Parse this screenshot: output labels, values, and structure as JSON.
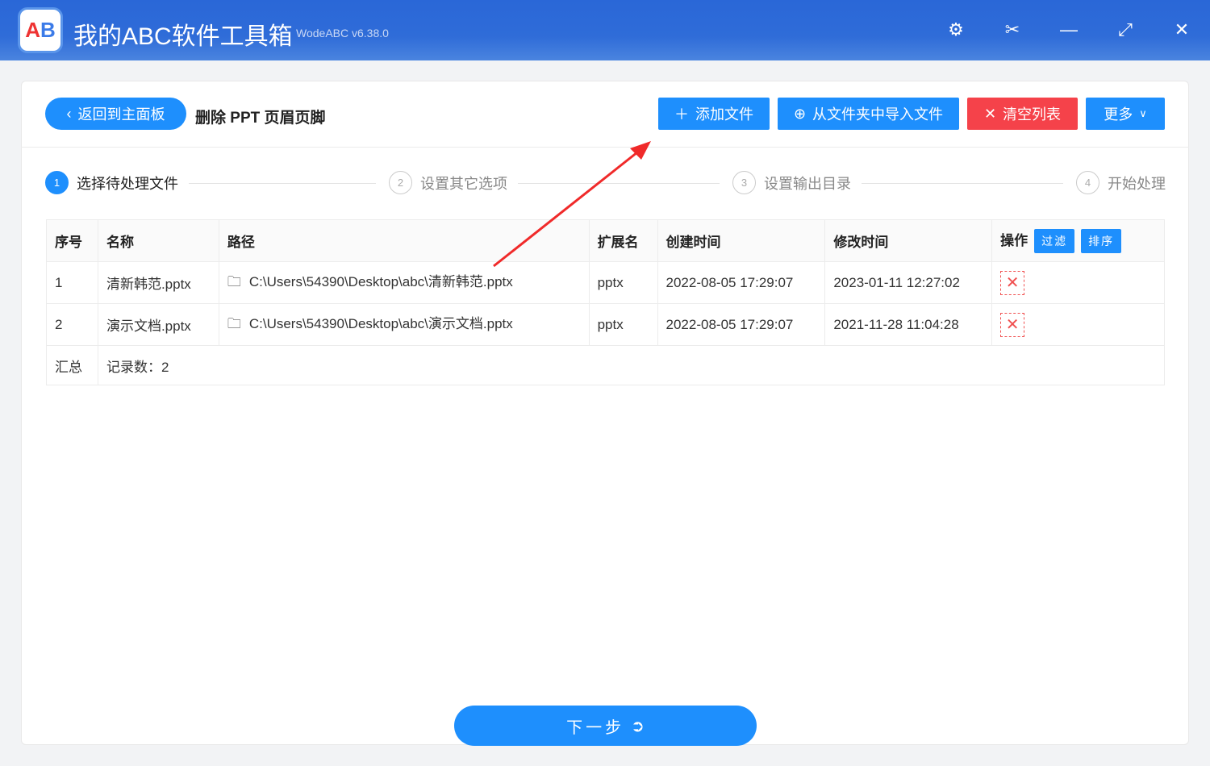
{
  "app": {
    "logo_text": "AB",
    "title": "我的ABC软件工具箱",
    "version": "WodeABC v6.38.0"
  },
  "window": {
    "settings": "⚙",
    "scissors": "✂",
    "minimize": "—",
    "maximize": "⤢",
    "close": "✕"
  },
  "header": {
    "back_label": "返回到主面板",
    "page_title": "删除 PPT 页眉页脚",
    "add_file": "添加文件",
    "import_folder": "从文件夹中导入文件",
    "clear_list": "清空列表",
    "more": "更多"
  },
  "steps": [
    {
      "num": "1",
      "label": "选择待处理文件"
    },
    {
      "num": "2",
      "label": "设置其它选项"
    },
    {
      "num": "3",
      "label": "设置输出目录"
    },
    {
      "num": "4",
      "label": "开始处理"
    }
  ],
  "table": {
    "headers": [
      "序号",
      "名称",
      "路径",
      "扩展名",
      "创建时间",
      "修改时间",
      "操作"
    ],
    "filter": "过滤",
    "sort": "排序",
    "rows": [
      {
        "no": "1",
        "name": "清新韩范.pptx",
        "path": "C:\\Users\\54390\\Desktop\\abc\\清新韩范.pptx",
        "ext": "pptx",
        "created": "2022-08-05 17:29:07",
        "modified": "2023-01-11 12:27:02"
      },
      {
        "no": "2",
        "name": "演示文档.pptx",
        "path": "C:\\Users\\54390\\Desktop\\abc\\演示文档.pptx",
        "ext": "pptx",
        "created": "2022-08-05 17:29:07",
        "modified": "2021-11-28 11:04:28"
      }
    ],
    "summary_label": "汇总",
    "summary_value": "记录数：2"
  },
  "footer": {
    "next": "下一步"
  }
}
